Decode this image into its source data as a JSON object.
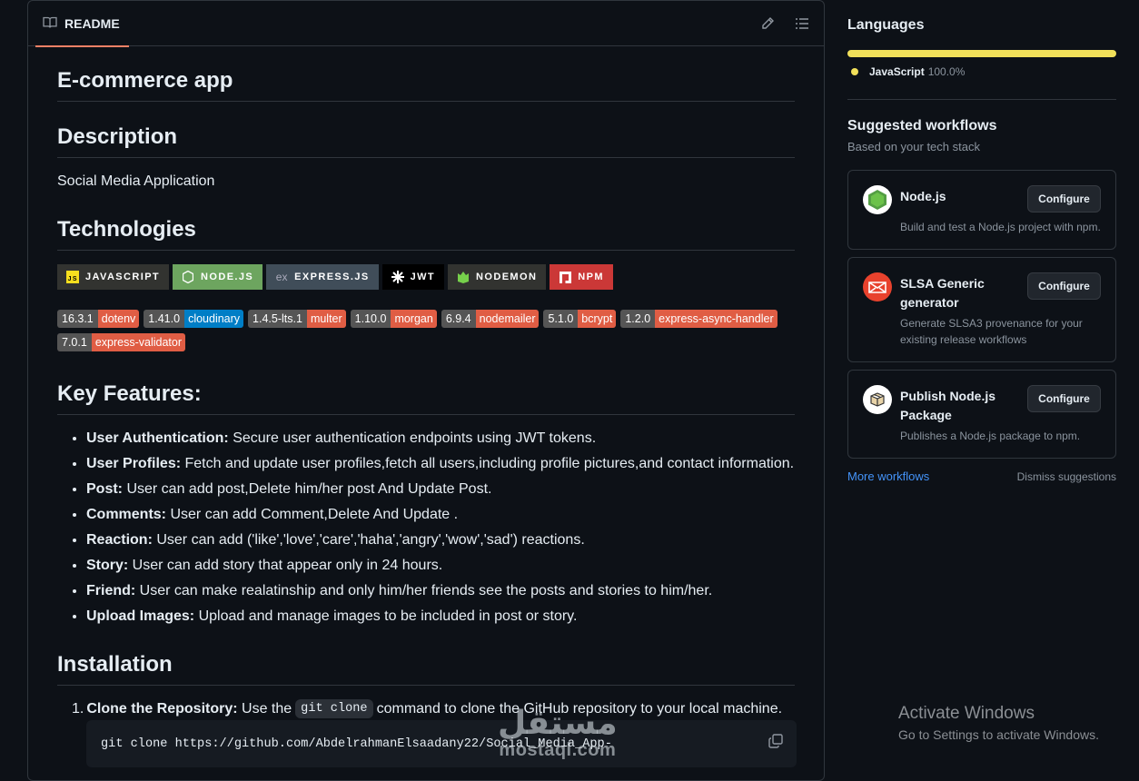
{
  "readme": {
    "tab_label": "README",
    "title": "E-commerce app",
    "description_heading": "Description",
    "description_text": "Social Media Application",
    "technologies_heading": "Technologies",
    "tech_badges": [
      {
        "label": "JAVASCRIPT",
        "color": "#323330",
        "icon": "js-logo-icon"
      },
      {
        "label": "NODE.JS",
        "color": "#6da55f",
        "icon": "nodejs-logo-icon"
      },
      {
        "label": "EXPRESS.JS",
        "color": "#404d59",
        "icon": "express-logo-icon"
      },
      {
        "label": "JWT",
        "color": "#000000",
        "icon": "jwt-logo-icon"
      },
      {
        "label": "NODEMON",
        "color": "#323330",
        "icon": "nodemon-logo-icon"
      },
      {
        "label": "NPM",
        "color": "#cb3837",
        "icon": "npm-logo-icon"
      }
    ],
    "version_badges": [
      {
        "version": "16.3.1",
        "name": "dotenv",
        "color": "#e05d44"
      },
      {
        "version": "1.41.0",
        "name": "cloudinary",
        "color": "#007ec6"
      },
      {
        "version": "1.4.5-lts.1",
        "name": "multer",
        "color": "#e05d44"
      },
      {
        "version": "1.10.0",
        "name": "morgan",
        "color": "#e05d44"
      },
      {
        "version": "6.9.4",
        "name": "nodemailer",
        "color": "#e05d44"
      },
      {
        "version": "5.1.0",
        "name": "bcrypt",
        "color": "#e05d44"
      },
      {
        "version": "1.2.0",
        "name": "express-async-handler",
        "color": "#e05d44"
      },
      {
        "version": "7.0.1",
        "name": "express-validator",
        "color": "#e05d44"
      }
    ],
    "features_heading": "Key Features:",
    "features": [
      {
        "title": "User Authentication:",
        "text": " Secure user authentication endpoints using JWT tokens."
      },
      {
        "title": "User Profiles:",
        "text": " Fetch and update user profiles,fetch all users,including profile pictures,and contact information."
      },
      {
        "title": "Post:",
        "text": " User can add post,Delete him/her post And Update Post."
      },
      {
        "title": "Comments:",
        "text": " User can add Comment,Delete And Update ."
      },
      {
        "title": "Reaction:",
        "text": " User can add ('like','love','care','haha','angry','wow','sad') reactions."
      },
      {
        "title": "Story:",
        "text": " User can add story that appear only in 24 hours."
      },
      {
        "title": "Friend:",
        "text": " User can make realatinship and only him/her friends see the posts and stories to him/her."
      },
      {
        "title": "Upload Images:",
        "text": " Upload and manage images to be included in post or story."
      }
    ],
    "installation_heading": "Installation",
    "install_step_number": "1.",
    "install_step_title": "Clone the Repository:",
    "install_step_pre": " Use the",
    "install_step_code": "git clone",
    "install_step_post": "command to clone the GitHub repository to your local machine.",
    "code_block": "git clone https://github.com/AbdelrahmanElsaadany22/Social_Media_App-"
  },
  "sidebar": {
    "languages_heading": "Languages",
    "languages": [
      {
        "name": "JavaScript",
        "percent": "100.0%",
        "color": "#f1e05a",
        "share": 1.0
      }
    ],
    "suggested_heading": "Suggested workflows",
    "suggested_sub": "Based on your tech stack",
    "workflows": [
      {
        "title": "Node.js",
        "desc": "Build and test a Node.js project with npm.",
        "button": "Configure",
        "icon": "nodejs-hexagon-icon"
      },
      {
        "title": "SLSA Generic generator",
        "desc": "Generate SLSA3 provenance for your existing release workflows",
        "button": "Configure",
        "icon": "slsa-logo-icon"
      },
      {
        "title": "Publish Node.js Package",
        "desc": "Publishes a Node.js package to npm.",
        "button": "Configure",
        "icon": "package-box-icon"
      }
    ],
    "more_workflows": "More workflows",
    "dismiss": "Dismiss suggestions"
  },
  "windows_notice": {
    "line1": "Activate Windows",
    "line2": "Go to Settings to activate Windows."
  },
  "watermark": {
    "arabic": "مستقل",
    "latin": "mostaql.com"
  }
}
